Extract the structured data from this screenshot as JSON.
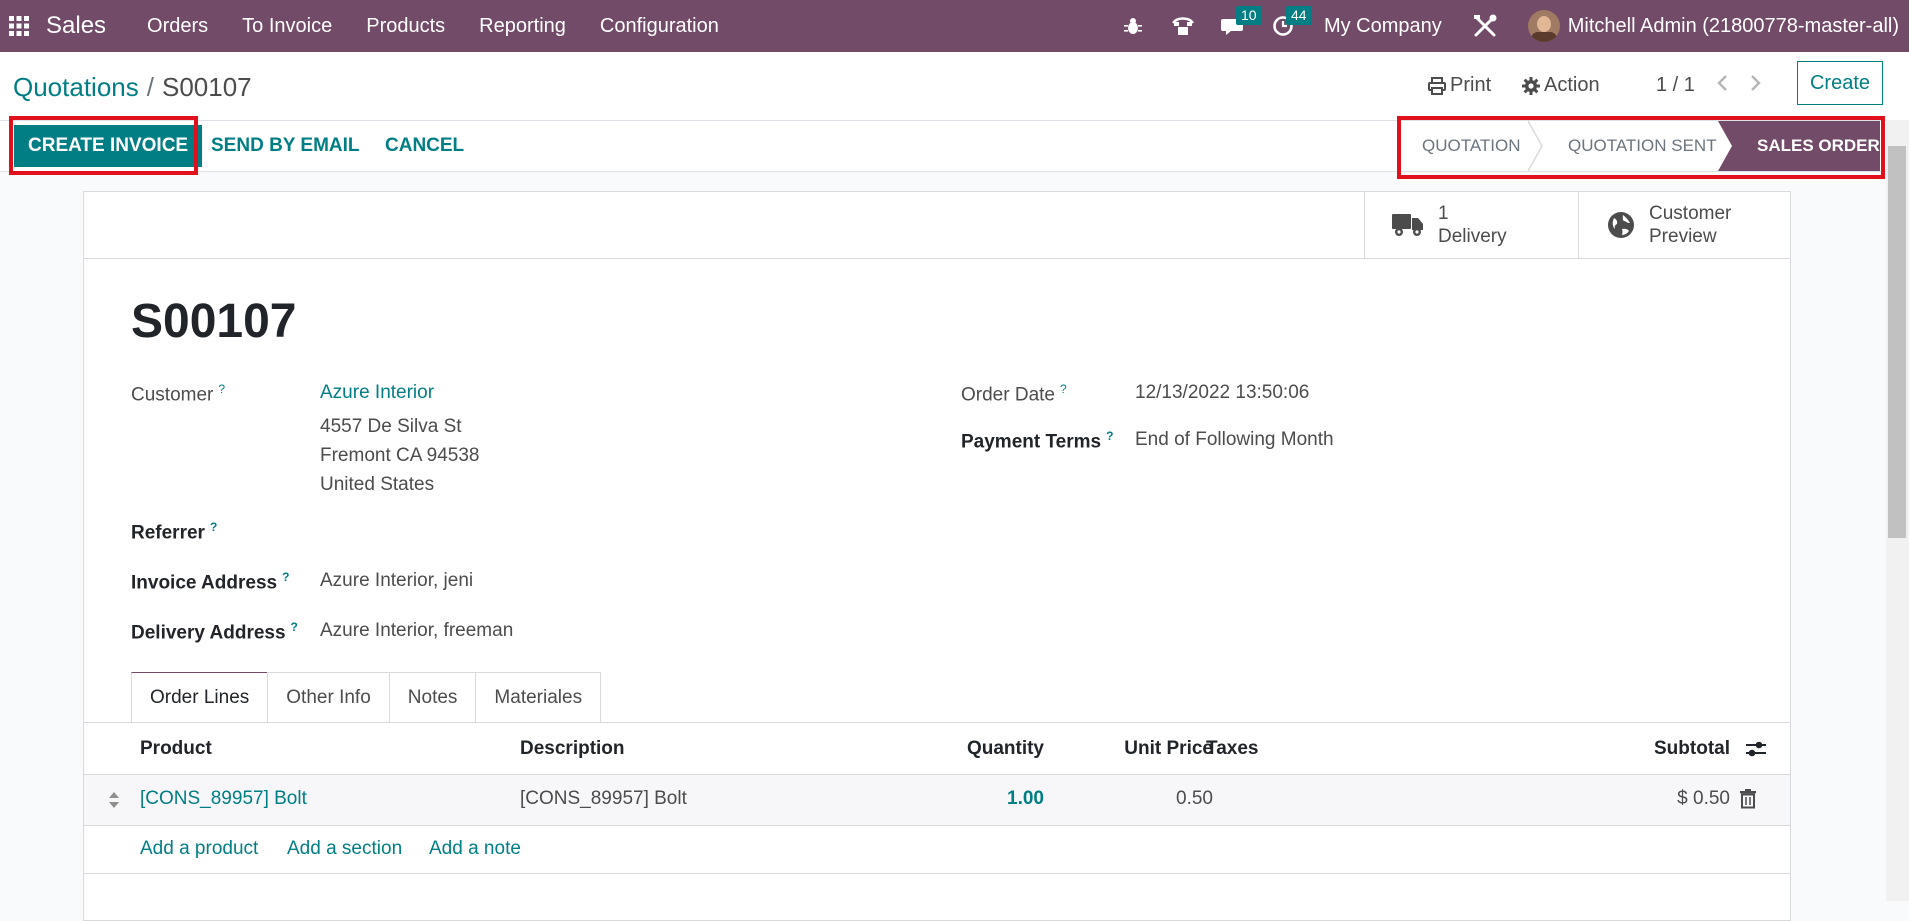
{
  "navbar": {
    "brand": "Sales",
    "menus": [
      "Orders",
      "To Invoice",
      "Products",
      "Reporting",
      "Configuration"
    ],
    "messages_count": "10",
    "activities_count": "44",
    "company": "My Company",
    "user": "Mitchell Admin (21800778-master-all)"
  },
  "breadcrumb": {
    "parent": "Quotations",
    "separator": "/",
    "current": "S00107"
  },
  "control": {
    "print_label": "Print",
    "action_label": "Action",
    "pager": "1 / 1",
    "create_label": "Create"
  },
  "header_buttons": {
    "create_invoice": "CREATE INVOICE",
    "send_email": "SEND BY EMAIL",
    "cancel": "CANCEL"
  },
  "statusbar": {
    "stages": [
      "QUOTATION",
      "QUOTATION SENT",
      "SALES ORDER"
    ],
    "active": "SALES ORDER"
  },
  "smart_buttons": {
    "delivery_count": "1",
    "delivery_label": "Delivery",
    "preview_line1": "Customer",
    "preview_line2": "Preview"
  },
  "form": {
    "title": "S00107",
    "customer_label": "Customer",
    "customer_name": "Azure Interior",
    "address_line1": "4557 De Silva St",
    "address_line2": "Fremont CA 94538",
    "address_line3": "United States",
    "referrer_label": "Referrer",
    "invoice_address_label": "Invoice Address",
    "invoice_address": "Azure Interior, jeni",
    "delivery_address_label": "Delivery Address",
    "delivery_address": "Azure Interior, freeman",
    "order_date_label": "Order Date",
    "order_date": "12/13/2022 13:50:06",
    "payment_terms_label": "Payment Terms",
    "payment_terms": "End of Following Month",
    "help_mark": "?"
  },
  "tabs": [
    "Order Lines",
    "Other Info",
    "Notes",
    "Materiales"
  ],
  "order_lines": {
    "columns": {
      "product": "Product",
      "description": "Description",
      "quantity": "Quantity",
      "unit_price": "Unit Price",
      "taxes": "Taxes",
      "subtotal": "Subtotal"
    },
    "rows": [
      {
        "product": "[CONS_89957] Bolt",
        "description": "[CONS_89957] Bolt",
        "quantity": "1.00",
        "unit_price": "0.50",
        "taxes": "",
        "subtotal": "$ 0.50"
      }
    ],
    "add_product": "Add a product",
    "add_section": "Add a section",
    "add_note": "Add a note"
  },
  "colors": {
    "brand": "#714b67",
    "accent": "#017e84",
    "highlight": "#e0111c"
  }
}
